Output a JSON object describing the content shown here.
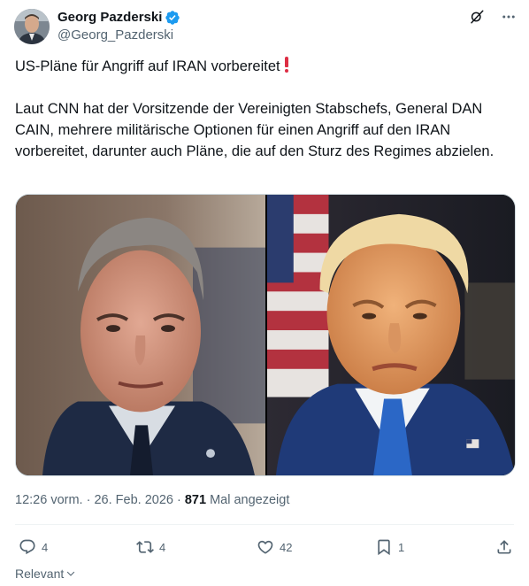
{
  "author": {
    "display_name": "Georg Pazderski",
    "handle": "@Georg_Pazderski",
    "verified": true
  },
  "header_icons": [
    "grok-icon",
    "more-icon"
  ],
  "tweet": {
    "line1": "US-Pläne für Angriff auf IRAN vorbereitet",
    "line1_emoji": "red-exclamation-mark",
    "paragraph2": "Laut CNN hat der Vorsitzende der Vereinigten Stabschefs, General DAN CAIN, mehrere militärische Optionen für einen Angriff auf den IRAN vorbereitet, darunter auch Pläne, die auf den Sturz des Regimes abzielen."
  },
  "media": {
    "images": [
      "left-photo",
      "right-photo"
    ]
  },
  "meta": {
    "time": "12:26 vorm.",
    "separator1": " · ",
    "date": "26. Feb. 2026",
    "separator2": " · ",
    "views_count": "871",
    "views_label": " Mal angezeigt"
  },
  "actions": {
    "replies": "4",
    "reposts": "4",
    "likes": "42",
    "bookmarks": "1"
  },
  "sort": {
    "label": "Relevant"
  },
  "colors": {
    "verified_blue": "#1d9bf0",
    "secondary_text": "#536471",
    "emoji_red": "#dd2e44"
  }
}
